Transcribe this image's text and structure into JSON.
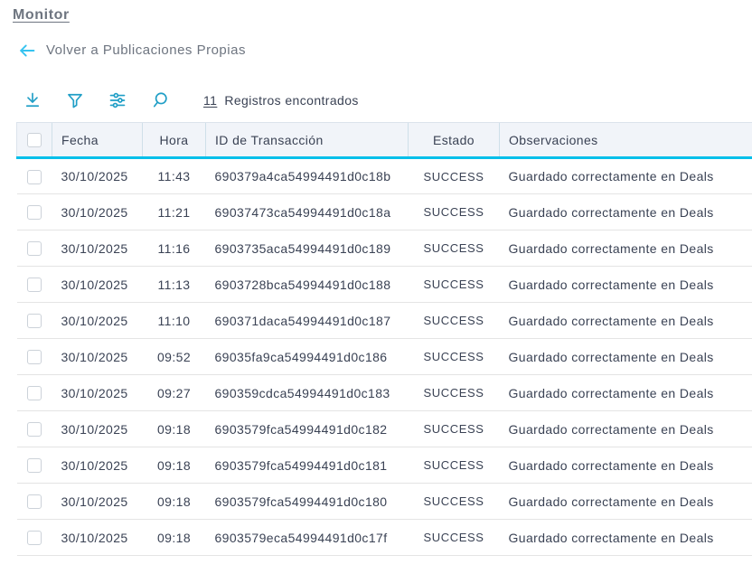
{
  "page": {
    "title": "Monitor",
    "back_link_label": "Volver a Publicaciones Propias"
  },
  "toolbar": {
    "icons": [
      "download-icon",
      "filter-icon",
      "sliders-icon",
      "search-icon"
    ],
    "results_count": "11",
    "results_label": "Registros encontrados"
  },
  "table": {
    "columns": [
      "Fecha",
      "Hora",
      "ID de Transacción",
      "Estado",
      "Observaciones"
    ],
    "rows": [
      {
        "fecha": "30/10/2025",
        "hora": "11:43",
        "id": "690379a4ca54994491d0c18b",
        "estado": "SUCCESS",
        "observaciones": "Guardado correctamente en Deals"
      },
      {
        "fecha": "30/10/2025",
        "hora": "11:21",
        "id": "69037473ca54994491d0c18a",
        "estado": "SUCCESS",
        "observaciones": "Guardado correctamente en Deals"
      },
      {
        "fecha": "30/10/2025",
        "hora": "11:16",
        "id": "6903735aca54994491d0c189",
        "estado": "SUCCESS",
        "observaciones": "Guardado correctamente en Deals"
      },
      {
        "fecha": "30/10/2025",
        "hora": "11:13",
        "id": "6903728bca54994491d0c188",
        "estado": "SUCCESS",
        "observaciones": "Guardado correctamente en Deals"
      },
      {
        "fecha": "30/10/2025",
        "hora": "11:10",
        "id": "690371daca54994491d0c187",
        "estado": "SUCCESS",
        "observaciones": "Guardado correctamente en Deals"
      },
      {
        "fecha": "30/10/2025",
        "hora": "09:52",
        "id": "69035fa9ca54994491d0c186",
        "estado": "SUCCESS",
        "observaciones": "Guardado correctamente en Deals"
      },
      {
        "fecha": "30/10/2025",
        "hora": "09:27",
        "id": "690359cdca54994491d0c183",
        "estado": "SUCCESS",
        "observaciones": "Guardado correctamente en Deals"
      },
      {
        "fecha": "30/10/2025",
        "hora": "09:18",
        "id": "6903579fca54994491d0c182",
        "estado": "SUCCESS",
        "observaciones": "Guardado correctamente en Deals"
      },
      {
        "fecha": "30/10/2025",
        "hora": "09:18",
        "id": "6903579fca54994491d0c181",
        "estado": "SUCCESS",
        "observaciones": "Guardado correctamente en Deals"
      },
      {
        "fecha": "30/10/2025",
        "hora": "09:18",
        "id": "6903579fca54994491d0c180",
        "estado": "SUCCESS",
        "observaciones": "Guardado correctamente en Deals"
      },
      {
        "fecha": "30/10/2025",
        "hora": "09:18",
        "id": "6903579eca54994491d0c17f",
        "estado": "SUCCESS",
        "observaciones": "Guardado correctamente en Deals"
      }
    ]
  },
  "colors": {
    "accent_cyan": "#00bfea",
    "icon_teal": "#1f9ec6",
    "back_arrow_blue": "#35c3f0",
    "header_bg": "#f1f4f9",
    "text_dark": "#3a4254",
    "text_gray": "#6e7580"
  }
}
